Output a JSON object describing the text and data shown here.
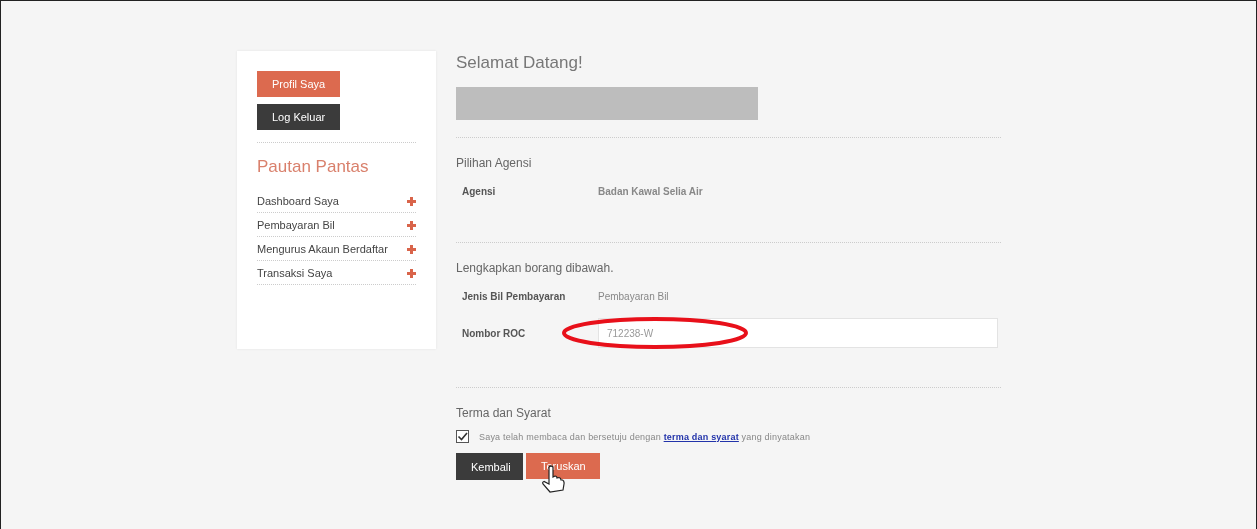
{
  "sidebar": {
    "buttons": [
      {
        "label": "Profil Saya",
        "kind": "primary"
      },
      {
        "label": "Log Keluar",
        "kind": "dark"
      }
    ],
    "title": "Pautan Pantas",
    "items": [
      {
        "label": "Dashboard Saya",
        "expanded": false
      },
      {
        "label": "Pembayaran Bil",
        "expanded": false
      },
      {
        "label": "Mengurus Akaun Berdaftar",
        "expanded": false
      },
      {
        "label": "Transaksi Saya",
        "expanded": false
      }
    ]
  },
  "main": {
    "title": "Selamat Datang!",
    "agency_section": {
      "heading": "Pilihan Agensi",
      "fields": [
        {
          "label": "Agensi",
          "value": "Badan Kawal Selia Air",
          "kind": "text"
        }
      ]
    },
    "form_section": {
      "heading": "Lengkapkan borang dibawah.",
      "fields": [
        {
          "label": "Jenis Bil Pembayaran",
          "value": "Pembayaran Bil",
          "kind": "text"
        },
        {
          "label": "Nombor ROC",
          "value": "712238-W",
          "kind": "input",
          "highlighted": true
        }
      ]
    },
    "terms": {
      "heading": "Terma dan Syarat",
      "checked": true,
      "text_before": "Saya telah membaca dan bersetuju dengan",
      "link": "terma dan syarat",
      "text_after": "yang dinyatakan"
    },
    "buttons": [
      {
        "label": "Kembali",
        "kind": "dark"
      },
      {
        "label": "Teruskan",
        "kind": "primary"
      }
    ]
  }
}
